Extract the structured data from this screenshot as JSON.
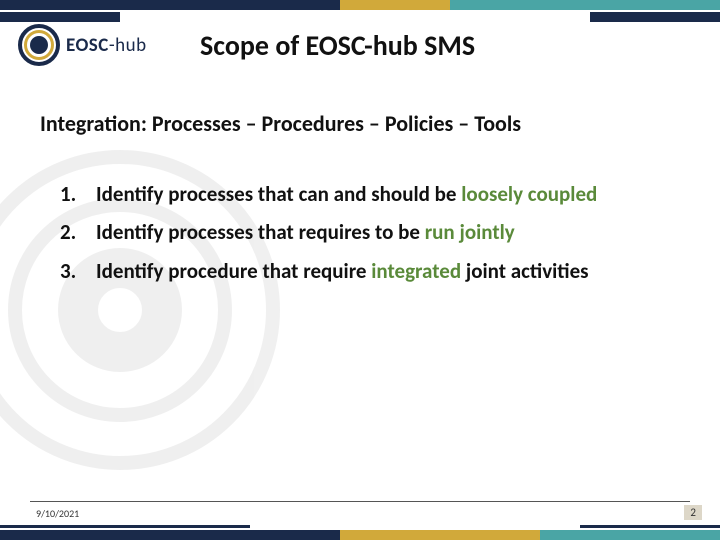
{
  "logo": {
    "brand": "EOSC",
    "suffix": "-hub"
  },
  "title": "Scope of EOSC-hub SMS",
  "subtitle": "Integration: Processes – Procedures – Policies – Tools",
  "list": [
    {
      "num": "1.",
      "pre": "Identify processes that can and should be ",
      "accent": "loosely coupled",
      "post": ""
    },
    {
      "num": "2.",
      "pre": "Identify processes that requires to be ",
      "accent": "run jointly",
      "post": ""
    },
    {
      "num": "3.",
      "pre": "Identify procedure that require ",
      "accent": "integrated",
      "post": " joint activities"
    }
  ],
  "footer": {
    "date": "9/10/2021",
    "page": "2"
  }
}
